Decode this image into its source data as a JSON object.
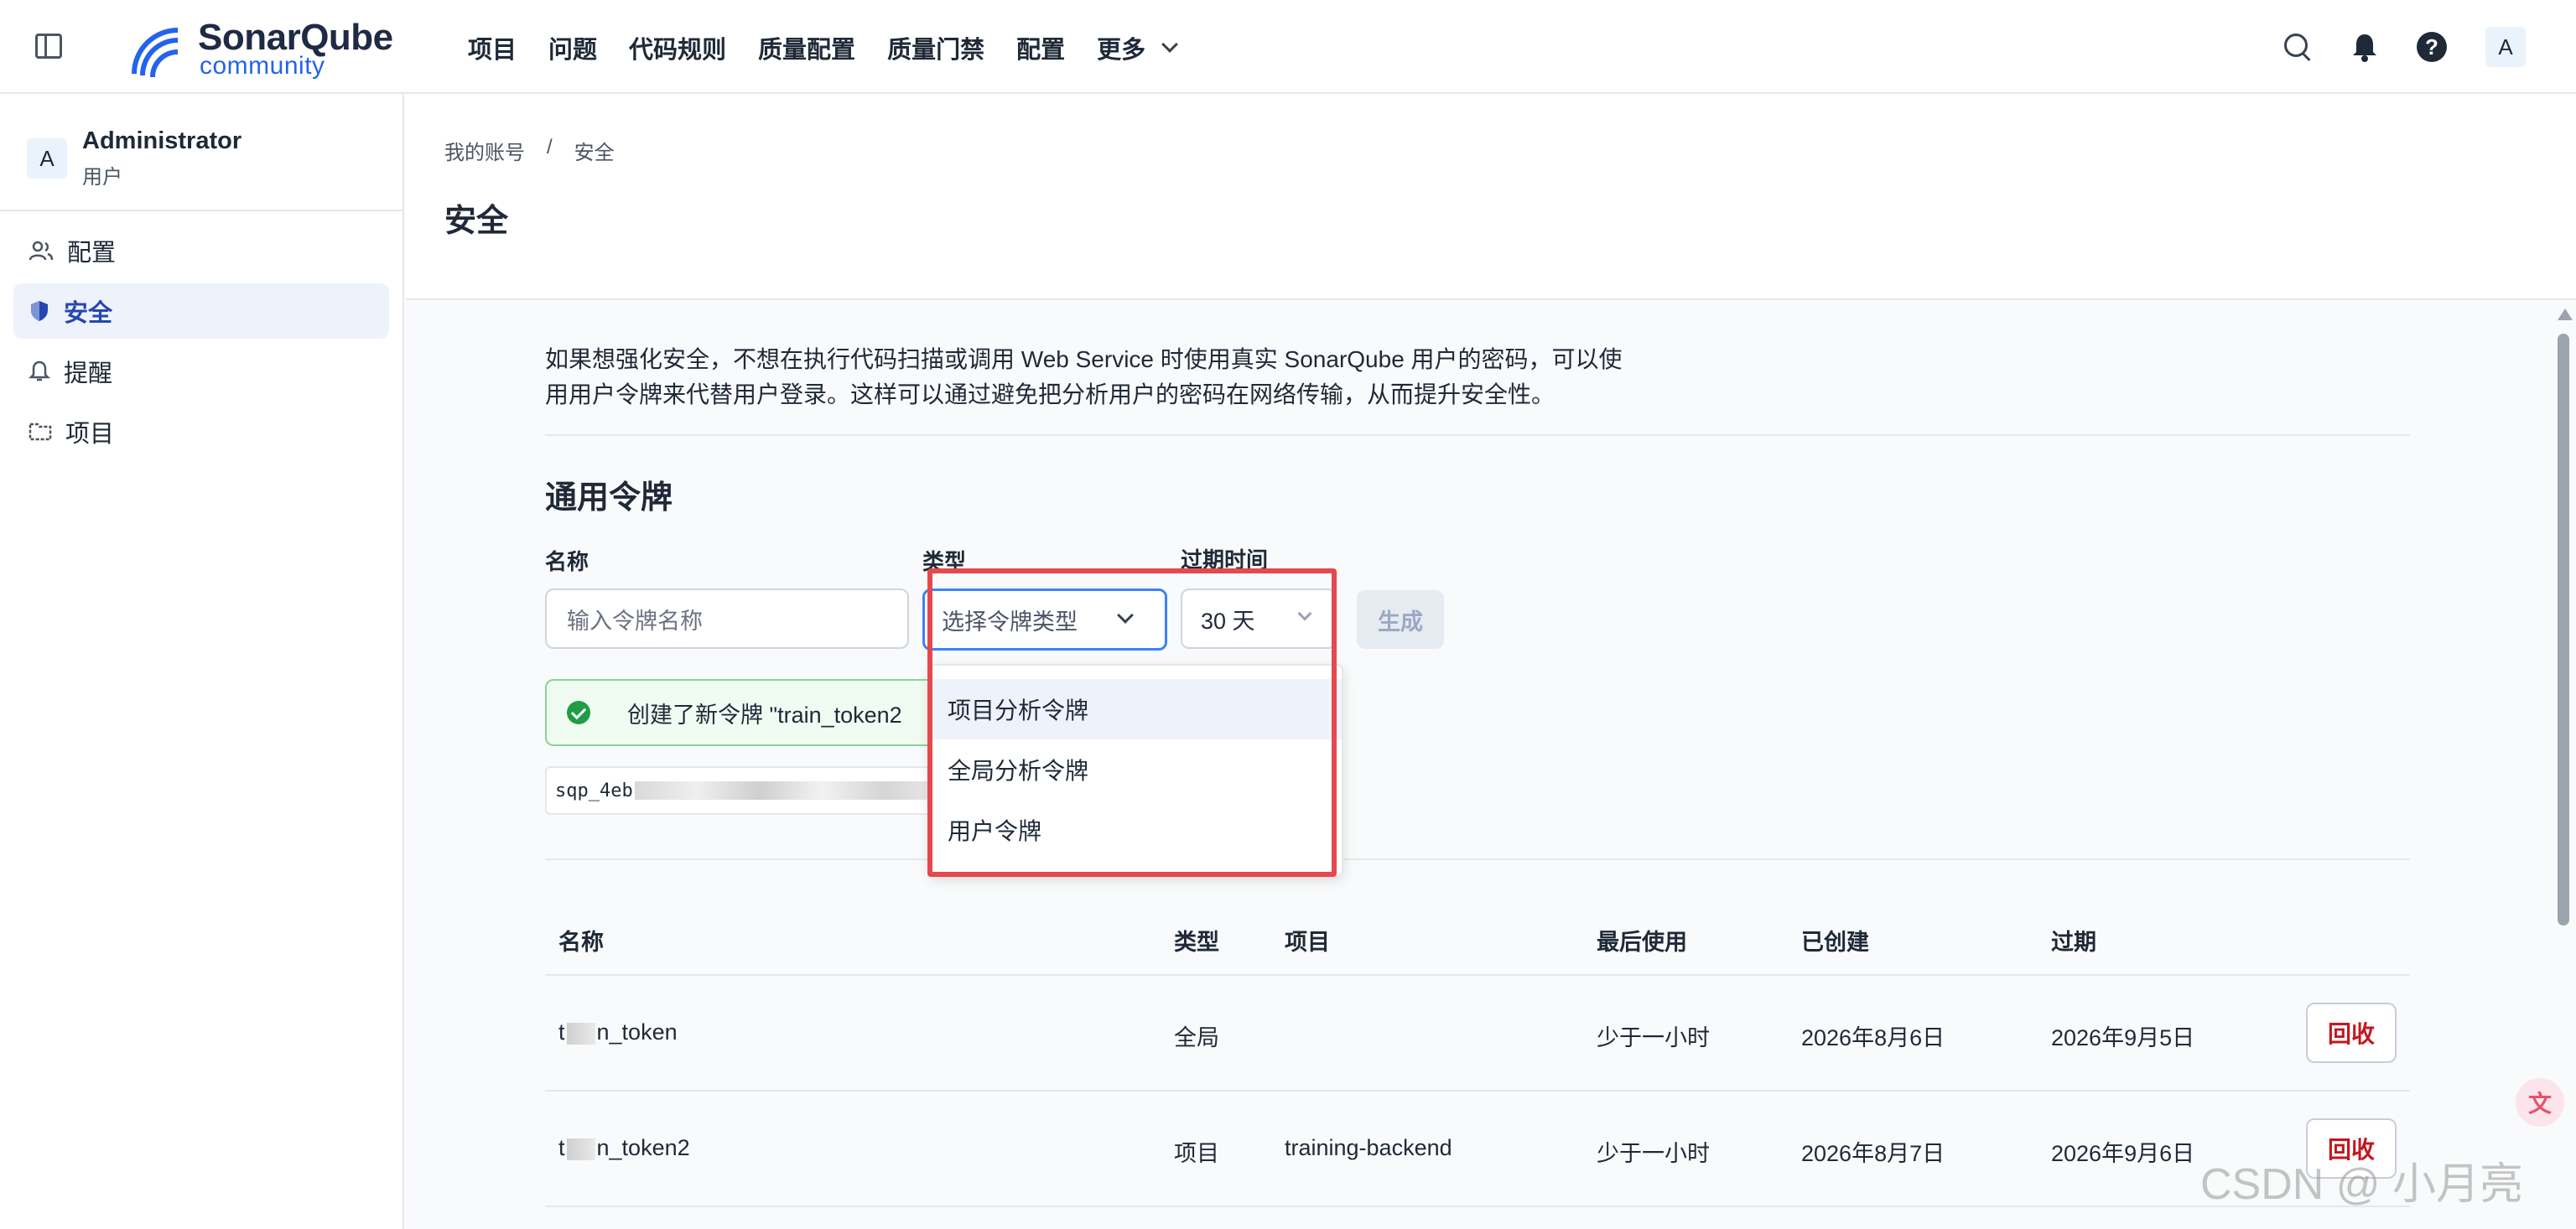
{
  "topbar": {
    "logo_name": "SonarQube",
    "logo_sub": "community",
    "nav": [
      "项目",
      "问题",
      "代码规则",
      "质量配置",
      "质量门禁",
      "配置"
    ],
    "more": "更多",
    "avatar_initial": "A"
  },
  "sidebar": {
    "user_initial": "A",
    "user_name": "Administrator",
    "user_role": "用户",
    "items": [
      {
        "label": "配置",
        "icon": "people-icon"
      },
      {
        "label": "安全",
        "icon": "shield-icon",
        "active": true
      },
      {
        "label": "提醒",
        "icon": "bell-icon"
      },
      {
        "label": "项目",
        "icon": "folder-icon"
      }
    ]
  },
  "header": {
    "breadcrumb": [
      "我的账号",
      "/",
      "安全"
    ],
    "title": "安全"
  },
  "main": {
    "intro_line1": "如果想强化安全，不想在执行代码扫描或调用 Web Service 时使用真实 SonarQube 用户的密码，可以使",
    "intro_line2": "用用户令牌来代替用户登录。这样可以通过避免把分析用户的密码在网络传输，从而提升安全性。",
    "section_title": "通用令牌",
    "form": {
      "name_label": "名称",
      "type_label": "类型",
      "expiry_label": "过期时间",
      "name_placeholder": "输入令牌名称",
      "type_placeholder": "选择令牌类型",
      "expiry_value": "30 天",
      "generate_label": "生成"
    },
    "alert_text": "创建了新令牌 \"train_token2",
    "token_prefix": "sqp_4eb",
    "dropdown_options": [
      "项目分析令牌",
      "全局分析令牌",
      "用户令牌"
    ],
    "table": {
      "headers": [
        "名称",
        "类型",
        "项目",
        "最后使用",
        "已创建",
        "过期"
      ],
      "rows": [
        {
          "name_start": "t",
          "name_end": "n_token",
          "type": "全局",
          "project": "",
          "last_used": "少于一小时",
          "created": "2026年8月6日",
          "expires": "2026年9月5日",
          "action": "回收"
        },
        {
          "name_start": "t",
          "name_end": "n_token2",
          "type": "项目",
          "project": "training-backend",
          "last_used": "少于一小时",
          "created": "2026年8月7日",
          "expires": "2026年9月6日",
          "action": "回收"
        }
      ]
    }
  },
  "watermark": "CSDN @ 小月亮",
  "colors": {
    "accent": "#2563eb",
    "active_bg": "#eef2fb",
    "danger": "#c2171f",
    "highlight": "#e5484d",
    "success": "#1f9d45"
  }
}
